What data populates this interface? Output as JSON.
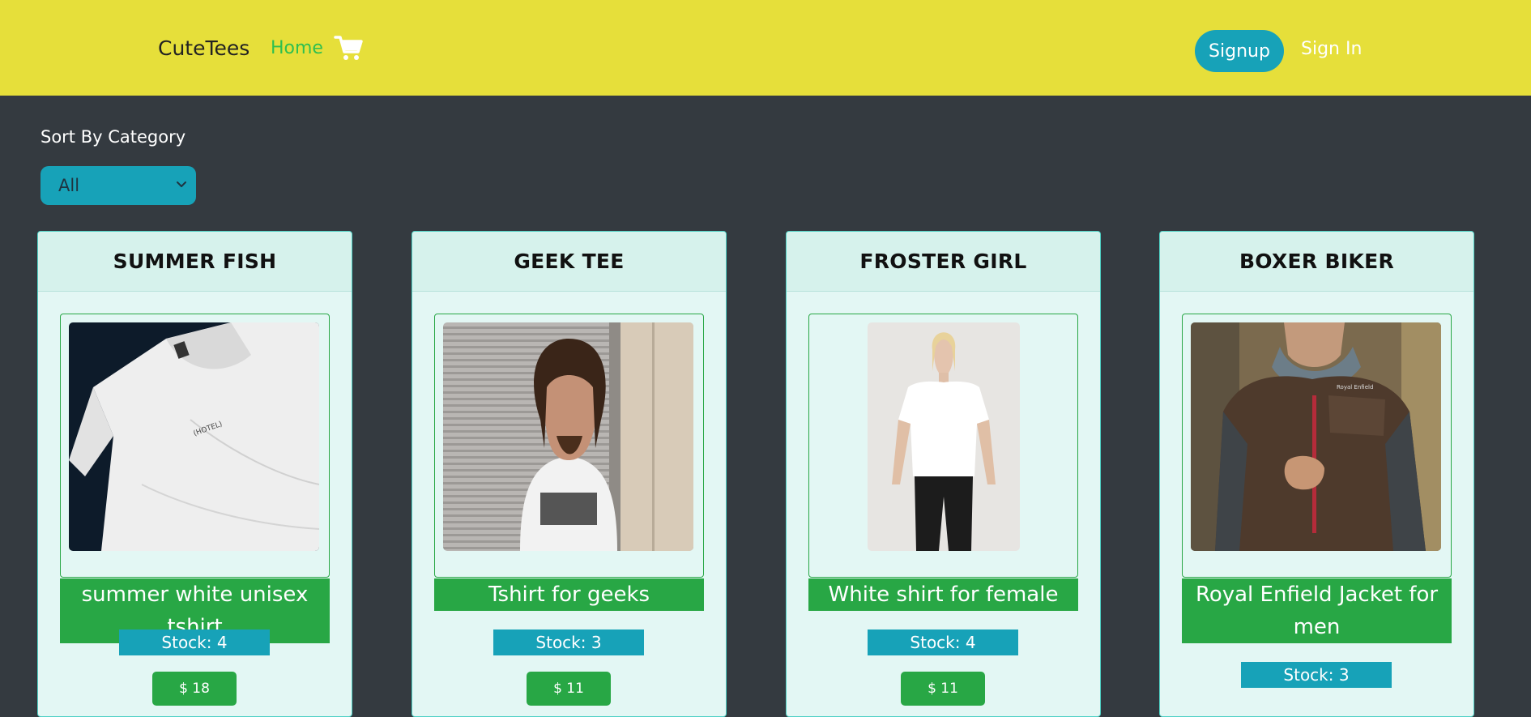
{
  "navbar": {
    "brand": "CuteTees",
    "home_label": "Home",
    "cart_icon": "shopping-cart-icon",
    "signup_label": "Signup",
    "signin_label": "Sign In"
  },
  "filter": {
    "label": "Sort By Category",
    "selected": "All"
  },
  "products": [
    {
      "title": "SUMMER FISH",
      "description": "summer white unisex tshirt",
      "stock": "Stock: 4",
      "price": "$ 18"
    },
    {
      "title": "GEEK TEE",
      "description": "Tshirt for geeks",
      "stock": "Stock: 3",
      "price": "$ 11"
    },
    {
      "title": "FROSTER GIRL",
      "description": "White shirt for female",
      "stock": "Stock: 4",
      "price": "$ 11"
    },
    {
      "title": "BOXER BIKER",
      "description": "Royal Enfield Jacket for men",
      "stock": "Stock: 3",
      "price": ""
    }
  ],
  "colors": {
    "navbar_bg": "#e6df3a",
    "page_bg": "#343a40",
    "info": "#17a2b8",
    "success": "#28a745",
    "card_bg": "#e3f7f4"
  }
}
